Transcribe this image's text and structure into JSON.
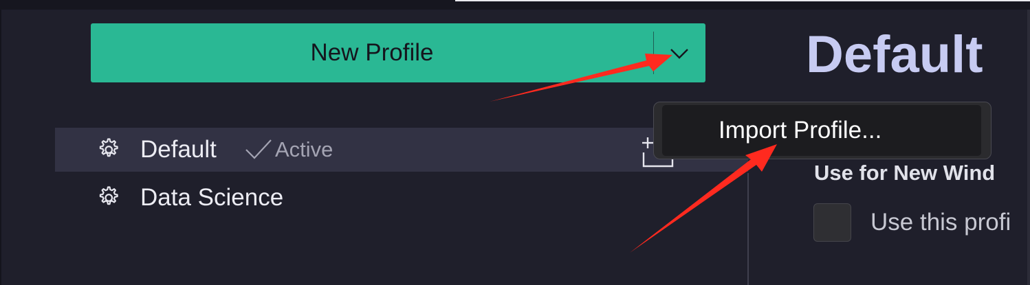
{
  "profiles_panel": {
    "new_profile_label": "New Profile",
    "profiles": [
      {
        "name": "Default",
        "active_label": "Active",
        "icon": "gear-icon"
      },
      {
        "name": "Data Science",
        "icon": "gear-icon"
      }
    ]
  },
  "context_menu": {
    "import_label": "Import Profile..."
  },
  "detail": {
    "title": "Default",
    "setting_heading": "Use for New Wind",
    "checkbox_label": "Use this profi"
  },
  "colors": {
    "accent": "#2ab894",
    "annotation_arrow": "#ff2a1f",
    "title": "#c7cbf2"
  },
  "icons": {
    "dropdown": "chevron-down-icon",
    "new_window": "new-window-icon",
    "active_check": "checkmark-icon"
  }
}
